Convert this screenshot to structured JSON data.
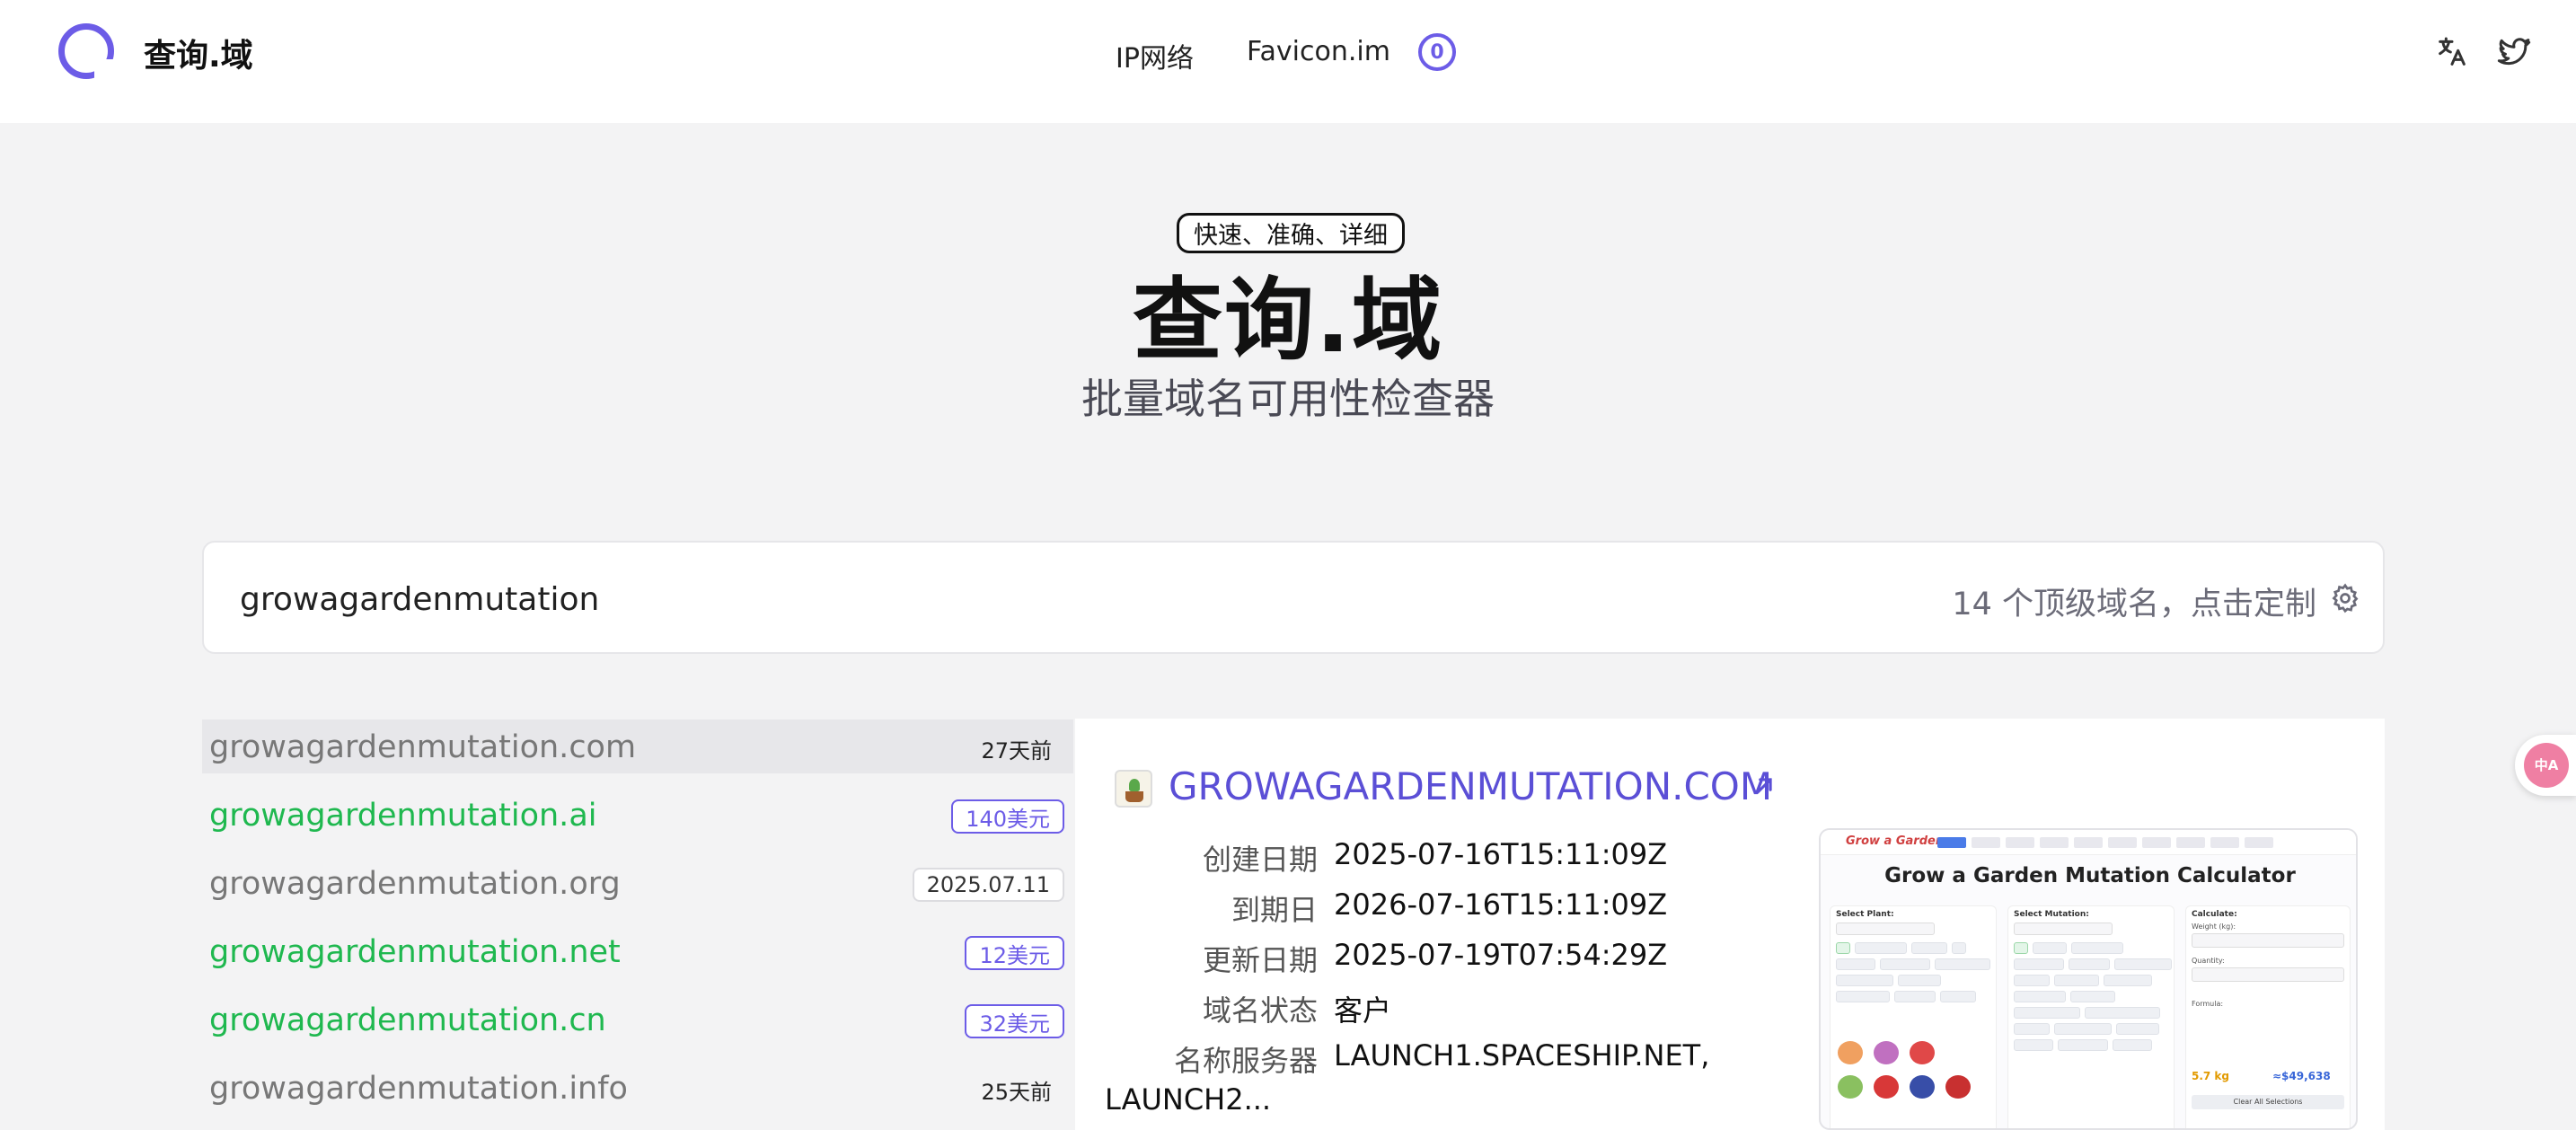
{
  "header": {
    "brand": "查询.域",
    "nav": {
      "ip_network": "IP网络",
      "favicon": "Favicon.im"
    },
    "badge": "0"
  },
  "hero": {
    "tagline": "快速、准确、详细",
    "title": "查询.域",
    "subtitle": "批量域名可用性检查器"
  },
  "search": {
    "value": "growagardenmutation",
    "tld_hint": "14 个顶级域名，点击定制"
  },
  "domains": [
    {
      "name": "growagardenmutation.com",
      "tag": "27天前",
      "status": "registered"
    },
    {
      "name": "growagardenmutation.ai",
      "tag": "140美元",
      "status": "available"
    },
    {
      "name": "growagardenmutation.org",
      "tag": "2025.07.11",
      "status": "registered"
    },
    {
      "name": "growagardenmutation.net",
      "tag": "12美元",
      "status": "available"
    },
    {
      "name": "growagardenmutation.cn",
      "tag": "32美元",
      "status": "available"
    },
    {
      "name": "growagardenmutation.info",
      "tag": "25天前",
      "status": "registered"
    }
  ],
  "detail": {
    "title": "GROWAGARDENMUTATION.COM",
    "fields": [
      {
        "key": "创建日期",
        "value": "2025-07-16T15:11:09Z"
      },
      {
        "key": "到期日",
        "value": "2026-07-16T15:11:09Z"
      },
      {
        "key": "更新日期",
        "value": "2025-07-19T07:54:29Z"
      },
      {
        "key": "域名状态",
        "value": "客户"
      },
      {
        "key": "名称服务器",
        "value": "LAUNCH1.SPACESHIP.NET,"
      }
    ],
    "nameserver_cont": "LAUNCH2...",
    "preview": {
      "brand": "Grow a Garden",
      "title": "Grow a Garden Mutation Calculator",
      "col1": "Select Plant:",
      "col2": "Select Mutation:",
      "col3": "Calculate:",
      "weight_label": "Weight (kg):",
      "quantity_label": "Quantity:",
      "formula_label": "Formula:",
      "final_value": "5.7 kg",
      "total_price": "≈$49,638",
      "clear": "Clear All Selections"
    }
  },
  "float_button": "中A",
  "colors": {
    "accent": "#6c5ce7",
    "available": "#1fb84f",
    "title_link": "#5b4fd6"
  }
}
